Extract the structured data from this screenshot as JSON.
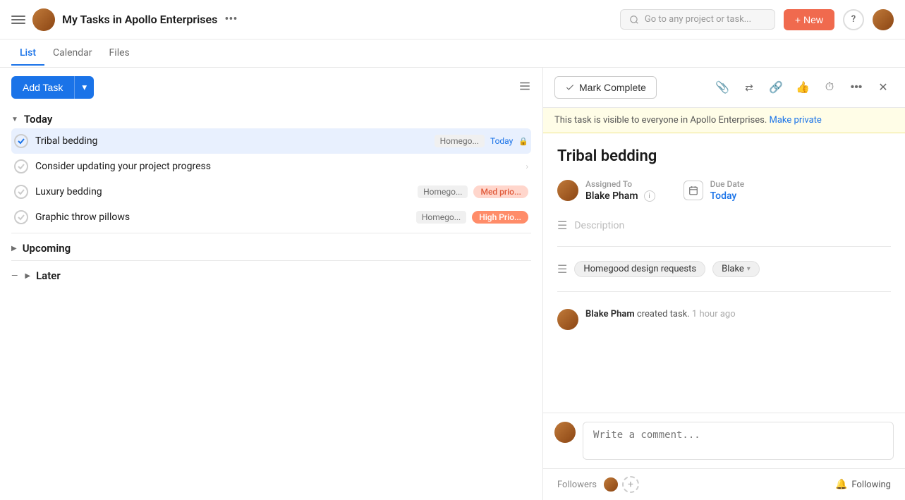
{
  "header": {
    "title": "My Tasks in Apollo Enterprises",
    "more_icon": "•••",
    "search_placeholder": "Go to any project or task...",
    "new_button": "+ New",
    "help_label": "?"
  },
  "tabs": [
    {
      "label": "List",
      "active": true
    },
    {
      "label": "Calendar",
      "active": false
    },
    {
      "label": "Files",
      "active": false
    }
  ],
  "toolbar": {
    "add_task": "Add Task",
    "filter_icon": "⇌"
  },
  "sections": [
    {
      "id": "today",
      "label": "Today",
      "collapsed": false,
      "tasks": [
        {
          "id": "t1",
          "name": "Tribal bedding",
          "project": "Homego...",
          "due": "Today",
          "tag": null,
          "selected": true
        },
        {
          "id": "t2",
          "name": "Consider updating your project progress",
          "project": null,
          "due": null,
          "tag": null,
          "selected": false,
          "has_chevron": true
        },
        {
          "id": "t3",
          "name": "Luxury bedding",
          "project": "Homego...",
          "due": null,
          "tag": "Med prio...",
          "tag_type": "med",
          "selected": false
        },
        {
          "id": "t4",
          "name": "Graphic throw pillows",
          "project": "Homego...",
          "due": null,
          "tag": "High Prio...",
          "tag_type": "high",
          "selected": false
        }
      ]
    },
    {
      "id": "upcoming",
      "label": "Upcoming",
      "collapsed": true,
      "tasks": []
    },
    {
      "id": "later",
      "label": "Later",
      "collapsed": true,
      "tasks": []
    }
  ],
  "task_detail": {
    "notification": "This task is visible to everyone in Apollo Enterprises.",
    "make_private": "Make private",
    "title": "Tribal bedding",
    "assigned_to_label": "Assigned To",
    "assignee_name": "Blake Pham",
    "due_date_label": "Due Date",
    "due_date_value": "Today",
    "description_placeholder": "Description",
    "project_label": "Homegood design requests",
    "assignee_tag": "Blake",
    "activity_text": "Blake Pham created task.",
    "activity_time": "1 hour ago",
    "comment_placeholder": "Write a comment...",
    "followers_label": "Followers",
    "following_label": "Following"
  },
  "mark_complete_btn": "Mark Complete",
  "toolbar_icons": {
    "attachment": "📎",
    "share": "⇌",
    "link": "🔗",
    "like": "👍",
    "timer": "⏱",
    "more": "•••",
    "close": "✕"
  }
}
